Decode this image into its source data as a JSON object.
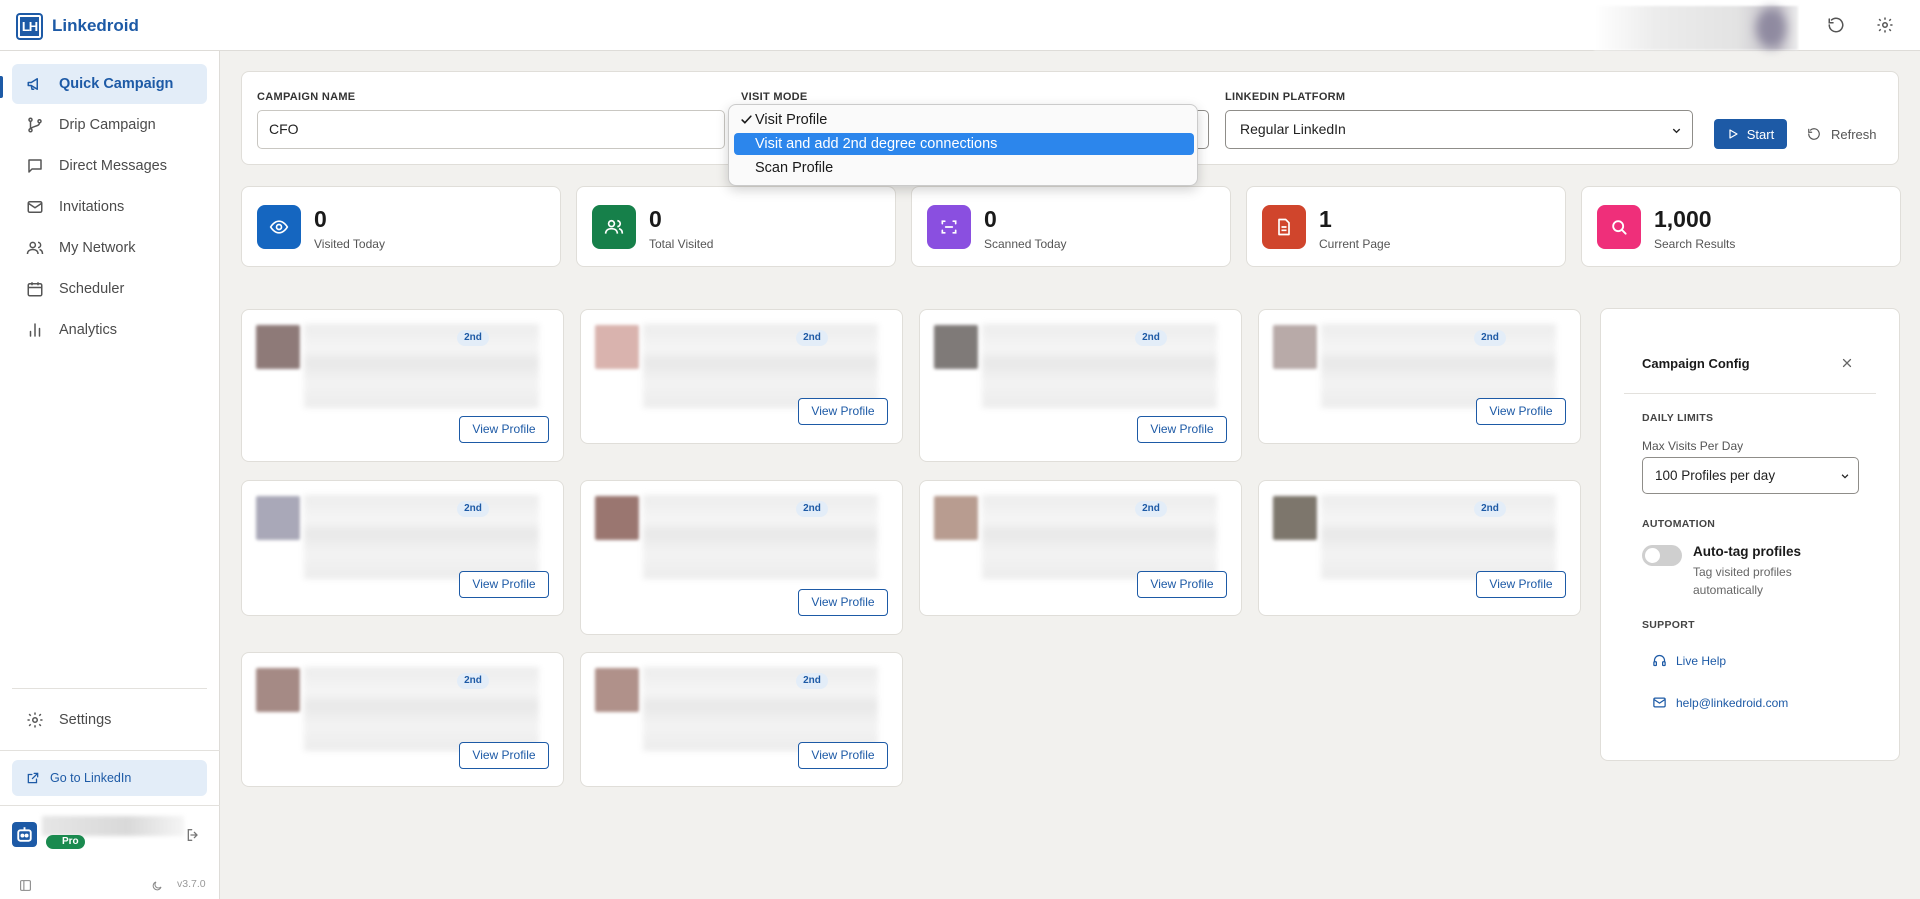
{
  "app": {
    "logo_text": "LH",
    "name": "Linkedroid"
  },
  "colors": {
    "brand": "#1d5aa6",
    "highlight": "#2c86ec",
    "visited": "#1566c0",
    "total": "#16804a",
    "scanned": "#8a4fe0",
    "page": "#d0452c",
    "search": "#ef2f7a"
  },
  "sidebar": {
    "items": [
      {
        "label": "Quick Campaign",
        "icon": "megaphone-icon",
        "active": true
      },
      {
        "label": "Drip Campaign",
        "icon": "branch-icon"
      },
      {
        "label": "Direct Messages",
        "icon": "message-icon"
      },
      {
        "label": "Invitations",
        "icon": "mail-icon"
      },
      {
        "label": "My Network",
        "icon": "users-icon"
      },
      {
        "label": "Scheduler",
        "icon": "calendar-icon"
      },
      {
        "label": "Analytics",
        "icon": "bar-chart-icon"
      }
    ],
    "settings_label": "Settings",
    "goto_label": "Go to LinkedIn",
    "plan_badge": "Pro",
    "version": "v3.7.0"
  },
  "form": {
    "campaign_name_label": "CAMPAIGN NAME",
    "campaign_name_value": "CFO",
    "visit_mode_label": "VISIT MODE",
    "platform_label": "LINKEDIN PLATFORM",
    "platform_value": "Regular LinkedIn",
    "start_label": "Start",
    "refresh_label": "Refresh"
  },
  "visit_mode_dropdown": {
    "options": [
      "Visit Profile",
      "Visit and add 2nd degree connections",
      "Scan Profile"
    ],
    "checked": "Visit Profile",
    "highlighted": "Visit and add 2nd degree connections"
  },
  "stats": [
    {
      "value": "0",
      "label": "Visited Today",
      "icon": "eye-icon"
    },
    {
      "value": "0",
      "label": "Total Visited",
      "icon": "users-icon"
    },
    {
      "value": "0",
      "label": "Scanned Today",
      "icon": "scan-icon"
    },
    {
      "value": "1",
      "label": "Current Page",
      "icon": "document-icon"
    },
    {
      "value": "1,000",
      "label": "Search Results",
      "icon": "search-icon"
    }
  ],
  "profiles": {
    "badge": "2nd",
    "button_label": "View Profile",
    "avatar_tints": [
      "#8e7a78",
      "#d9b3ae",
      "#7f7a78",
      "#b8aaa8",
      "#a9a8b8",
      "#9a7670",
      "#b89c90",
      "#7d766c",
      "#a58a85",
      "#b0918a"
    ]
  },
  "config": {
    "title": "Campaign Config",
    "daily_limits_label": "DAILY LIMITS",
    "max_visits_label": "Max Visits Per Day",
    "max_visits_value": "100 Profiles per day",
    "automation_label": "AUTOMATION",
    "auto_tag_title": "Auto-tag profiles",
    "auto_tag_desc_1": "Tag visited profiles",
    "auto_tag_desc_2": "automatically",
    "support_label": "SUPPORT",
    "live_help_label": "Live Help",
    "email_label": "help@linkedroid.com"
  }
}
